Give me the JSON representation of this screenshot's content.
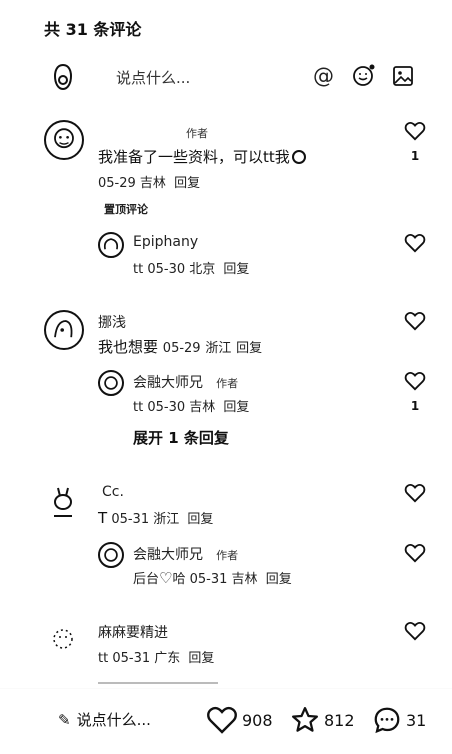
{
  "header": {
    "title": "共 31 条评论"
  },
  "compose": {
    "placeholder": "说点什么...",
    "at_symbol": "@"
  },
  "comments": [
    {
      "username": "",
      "author_tag": "作者",
      "content": "我准备了一些资料，可以tt我",
      "date": "05-29",
      "location": "吉林",
      "reply_label": "回复",
      "like_count": "1",
      "sub_link": "置顶评论",
      "replies": [
        {
          "username": "Epiphany",
          "prefix": "tt",
          "date": "05-30",
          "location": "北京",
          "reply_label": "回复"
        }
      ]
    },
    {
      "username": "挪浅",
      "content": "我也想要",
      "date": "05-29",
      "location": "浙江",
      "reply_label": "回复",
      "replies": [
        {
          "username": "会融大师兄",
          "author_tag": "作者",
          "prefix": "tt",
          "date": "05-30",
          "location": "吉林",
          "reply_label": "回复",
          "like_count": "1"
        }
      ],
      "expand_label": "展开 1 条回复"
    },
    {
      "username": "Cc.",
      "content": "T",
      "date": "05-31",
      "location": "浙江",
      "reply_label": "回复",
      "replies": [
        {
          "username": "会融大师兄",
          "author_tag": "作者",
          "prefix_a": "后台",
          "prefix_b": "哈",
          "date": "05-31",
          "location": "吉林",
          "reply_label": "回复"
        }
      ]
    },
    {
      "username": "麻麻要精进",
      "content": "tt",
      "date": "05-31",
      "location": "广东",
      "reply_label": "回复"
    }
  ],
  "bottom_bar": {
    "write_placeholder": "说点什么...",
    "likes": "908",
    "favorites": "812",
    "comments": "31"
  }
}
